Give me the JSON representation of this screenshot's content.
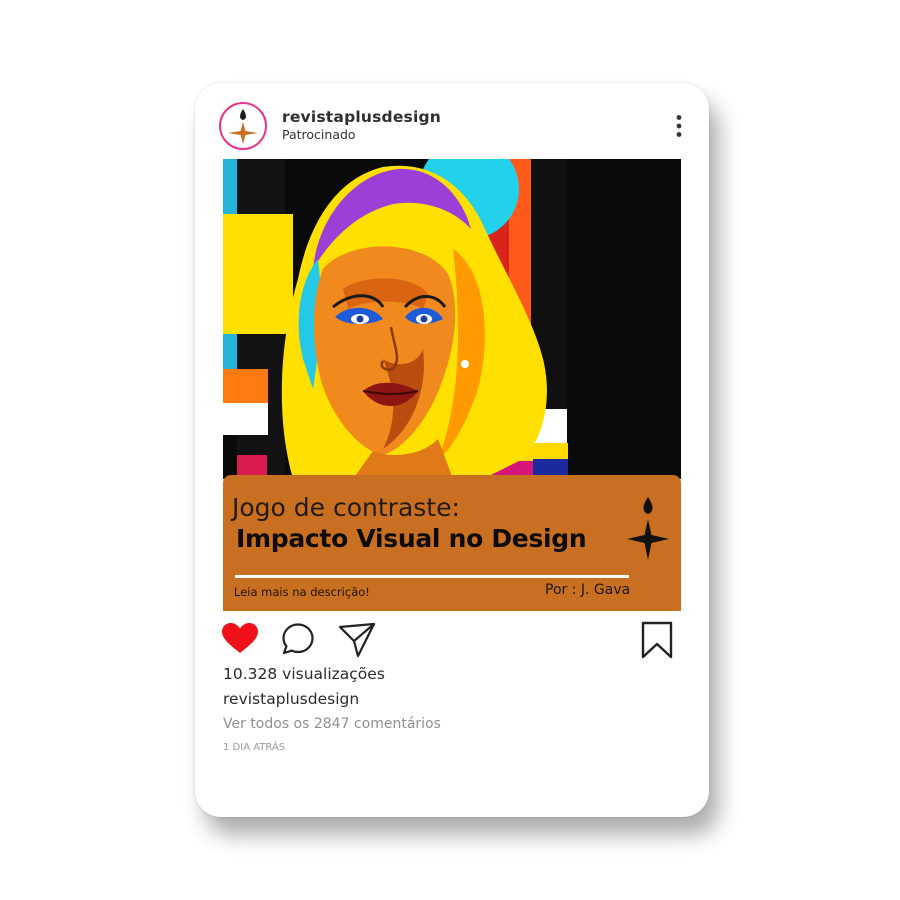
{
  "header": {
    "username": "revistaplusdesign",
    "subtitle": "Patrocinado"
  },
  "banner": {
    "title_line1": "Jogo de contraste:",
    "title_line2": "Impacto Visual no Design",
    "read_more": "Leia mais na descrição!",
    "author": "Por :  J. Gava"
  },
  "stats": {
    "views": "10.328 visualizações",
    "username": "revistaplusdesign",
    "comments_link": "Ver todos os 2847 comentários",
    "time": "1 DIA ATRÁS"
  },
  "colors": {
    "brand_orange": "#c96f22",
    "like_red": "#f0111a",
    "avatar_ring": "#e8338a",
    "art_cyan": "#23d1ea",
    "art_yellow": "#ffd900",
    "art_red": "#d9241c"
  },
  "icons": {
    "avatar": "brush-cross-logo-icon",
    "more": "more-vertical-icon",
    "like": "heart-icon",
    "comment": "comment-bubble-icon",
    "share": "send-icon",
    "save": "bookmark-icon"
  }
}
